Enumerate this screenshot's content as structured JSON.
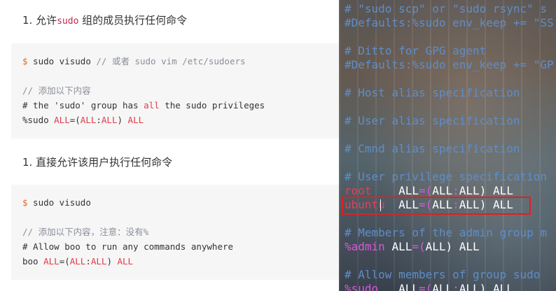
{
  "doc": {
    "section1": {
      "prefix": "1. 允许",
      "code": "sudo",
      "suffix": " 组的成员执行任何命令"
    },
    "block1": {
      "prompt": "$",
      "cmd": " sudo visudo ",
      "cmd_comment": "// 或者 sudo vim /etc/sudoers",
      "comment": "// 添加以下内容",
      "line3_a": "# the 'sudo' group has ",
      "line3_kw": "all",
      "line3_b": " the sudo privileges",
      "line4_a": "%sudo ",
      "line4_kw1": "ALL",
      "line4_eq": "=(",
      "line4_kw2": "ALL",
      "line4_colon": ":",
      "line4_kw3": "ALL",
      "line4_close": ") ",
      "line4_kw4": "ALL"
    },
    "section2": {
      "text": "1. 直接允许该用户执行任何命令"
    },
    "block2": {
      "prompt": "$",
      "cmd": " sudo visudo",
      "comment": "// 添加以下内容，注意：没有%",
      "line3": "# Allow boo to run any commands anywhere",
      "line4_a": "boo ",
      "line4_kw1": "ALL",
      "line4_eq": "=(",
      "line4_kw2": "ALL",
      "line4_colon": ":",
      "line4_kw3": "ALL",
      "line4_close": ") ",
      "line4_kw4": "ALL"
    }
  },
  "terminal": {
    "l1": "# \"sudo scp\" or \"sudo rsync\" s",
    "l2": "#Defaults:%sudo env_keep += \"SS",
    "l3": "# Ditto for GPG agent",
    "l4": "#Defaults:%sudo env_keep += \"GP",
    "l5": "# Host alias specification",
    "l6": "# User alias specification",
    "l7": "# Cmnd alias specification",
    "l8": "# User privilege specification",
    "root_user": "root",
    "root_pad": "    ",
    "ubuntu_user": "ubuntu",
    "ubuntu_pad": "  ",
    "all": "ALL",
    "eq_open": "=(",
    "colon": ":",
    "close": ") ",
    "l11": "# Members of the admin group m",
    "admin_group": "%admin",
    "admin_sp": " ",
    "admin_all1": "ALL",
    "admin_eq": "=(",
    "admin_all2": "ALL",
    "admin_close": ") ",
    "admin_all3": "ALL",
    "l13": "# Allow members of group sudo",
    "sudo_group": "%sudo",
    "sudo_pad": "   "
  },
  "colors": {
    "terminal_comment": "#5e8ec9",
    "terminal_user": "#e0405a",
    "terminal_group": "#d957d9",
    "highlight_box": "#e02020",
    "doc_prompt": "#e46a24",
    "doc_keyword": "#e0394a"
  }
}
